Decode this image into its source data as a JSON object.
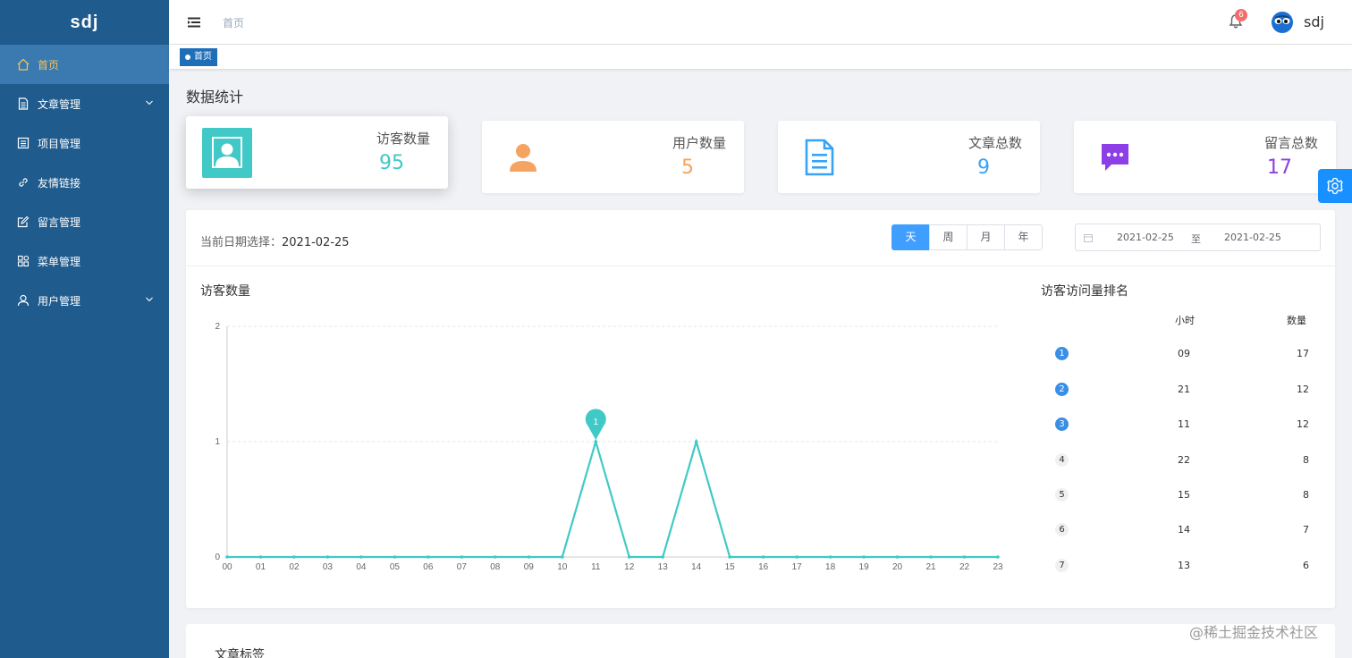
{
  "app": {
    "logo": "sdj"
  },
  "sidebar": {
    "items": [
      {
        "label": "首页",
        "icon": "home-icon",
        "active": true,
        "has_arrow": false
      },
      {
        "label": "文章管理",
        "icon": "document-icon",
        "active": false,
        "has_arrow": true
      },
      {
        "label": "项目管理",
        "icon": "list-icon",
        "active": false,
        "has_arrow": false
      },
      {
        "label": "友情链接",
        "icon": "link-icon",
        "active": false,
        "has_arrow": false
      },
      {
        "label": "留言管理",
        "icon": "edit-icon",
        "active": false,
        "has_arrow": false
      },
      {
        "label": "菜单管理",
        "icon": "grid-icon",
        "active": false,
        "has_arrow": false
      },
      {
        "label": "用户管理",
        "icon": "user-icon",
        "active": false,
        "has_arrow": true
      }
    ]
  },
  "header": {
    "breadcrumb": "首页",
    "notification_count": "6",
    "user_name": "sdj"
  },
  "tags": {
    "active_tag": "首页"
  },
  "main": {
    "section_title": "数据统计",
    "stats": [
      {
        "label": "访客数量",
        "value": "95",
        "color": "#40c9c6",
        "icon": "visitor-icon"
      },
      {
        "label": "用户数量",
        "value": "5",
        "color": "#f4a460",
        "icon": "user-icon"
      },
      {
        "label": "文章总数",
        "value": "9",
        "color": "#36a3f7",
        "icon": "document-icon"
      },
      {
        "label": "留言总数",
        "value": "17",
        "color": "#8e3ee6",
        "icon": "message-icon"
      }
    ],
    "date_picker": {
      "label": "当前日期选择：",
      "value": "2021-02-25",
      "segments": [
        "天",
        "周",
        "月",
        "年"
      ],
      "active_segment": "天",
      "range_start": "2021-02-25",
      "range_sep": "至",
      "range_end": "2021-02-25"
    },
    "chart_title": "访客数量",
    "ranking": {
      "title": "访客访问量排名",
      "col_hour": "小时",
      "col_count": "数量",
      "rows": [
        {
          "rank": "1",
          "hour": "09",
          "count": "17"
        },
        {
          "rank": "2",
          "hour": "21",
          "count": "12"
        },
        {
          "rank": "3",
          "hour": "11",
          "count": "12"
        },
        {
          "rank": "4",
          "hour": "22",
          "count": "8"
        },
        {
          "rank": "5",
          "hour": "15",
          "count": "8"
        },
        {
          "rank": "6",
          "hour": "14",
          "count": "7"
        },
        {
          "rank": "7",
          "hour": "13",
          "count": "6"
        }
      ]
    },
    "tags_panel_title": "文章标签"
  },
  "chart_data": {
    "type": "line",
    "title": "访客数量",
    "x": [
      "00",
      "01",
      "02",
      "03",
      "04",
      "05",
      "06",
      "07",
      "08",
      "09",
      "10",
      "11",
      "12",
      "13",
      "14",
      "15",
      "16",
      "17",
      "18",
      "19",
      "20",
      "21",
      "22",
      "23"
    ],
    "series": [
      {
        "values": [
          0,
          0,
          0,
          0,
          0,
          0,
          0,
          0,
          0,
          0,
          0,
          1,
          0,
          0,
          1,
          0,
          0,
          0,
          0,
          0,
          0,
          0,
          0,
          0
        ]
      }
    ],
    "ylim": [
      0,
      2
    ],
    "yticks": [
      0,
      1,
      2
    ],
    "markpoint": {
      "x": "11",
      "value": 1
    },
    "color": "#40c9c6",
    "grid": "horizontal-dashed"
  },
  "watermark": "@稀土掘金技术社区"
}
